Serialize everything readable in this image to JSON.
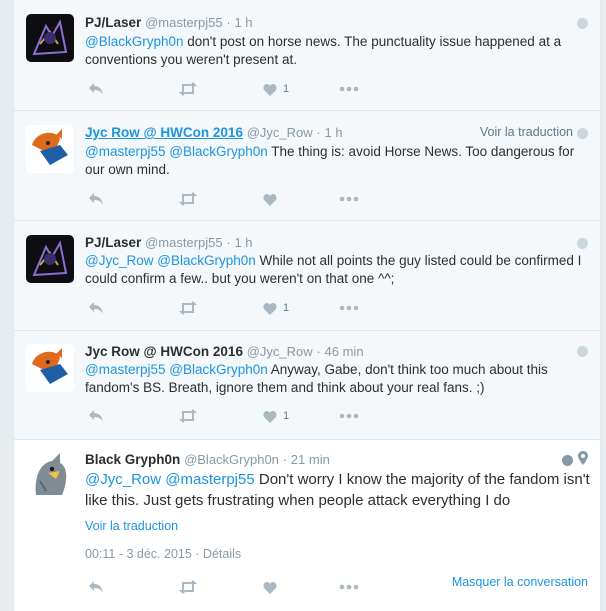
{
  "tweets": [
    {
      "name": "PJ/Laser",
      "handle": "@masterpj55",
      "sep": "·",
      "time": "1 h",
      "mention1": "@BlackGryph0n",
      "text": " don't post on horse news. The punctuality issue happened  at a conventions you weren't present at.",
      "likes": "1"
    },
    {
      "name": "Jyc Row @ HWCon 2016",
      "handle": "@Jyc_Row",
      "sep": "·",
      "time": "1 h",
      "translate": "Voir la traduction",
      "mention1": "@masterpj55",
      "mention2": "@BlackGryph0n",
      "text": " The thing is: avoid Horse News. Too dangerous for our own mind.",
      "likes": ""
    },
    {
      "name": "PJ/Laser",
      "handle": "@masterpj55",
      "sep": "·",
      "time": "1 h",
      "mention1": "@Jyc_Row",
      "mention2": "@BlackGryph0n",
      "text": " While not all points the guy listed could be confirmed I could confirm a few.. but you weren't on that one ^^;",
      "likes": "1"
    },
    {
      "name": "Jyc Row @ HWCon 2016",
      "handle": "@Jyc_Row",
      "sep": "·",
      "time": "46 min",
      "mention1": "@masterpj55",
      "mention2": "@BlackGryph0n",
      "text": " Anyway, Gabe, don't think too much about this fandom's BS. Breath, ignore them and think about your real fans. ;)",
      "likes": "1"
    },
    {
      "name": "Black Gryph0n",
      "handle": "@BlackGryph0n",
      "sep": "·",
      "time": "21 min",
      "mention1": "@Jyc_Row",
      "mention2": "@masterpj55",
      "text": " Don't worry I know the majority of the fandom isn't like this. Just gets frustrating when people attack everything I do",
      "translate": "Voir la traduction",
      "date": "00:11 - 3 déc. 2015",
      "details": "· Détails",
      "hide": "Masquer la conversation"
    }
  ],
  "colors": {
    "link": "#1b95e0",
    "muted": "#8899a6",
    "icon": "#aab8c2",
    "bg": "#f5f8fa"
  }
}
